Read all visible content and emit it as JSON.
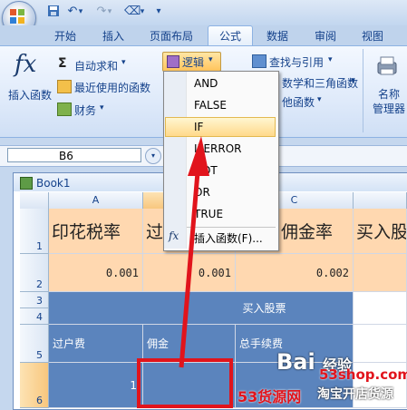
{
  "qat": {
    "save_icon": "save-icon",
    "undo_icon": "undo-icon",
    "redo_icon": "redo-icon",
    "eraser_icon": "eraser-icon",
    "customize": "▾"
  },
  "tabs": [
    "开始",
    "插入",
    "页面布局",
    "公式",
    "数据",
    "审阅",
    "视图"
  ],
  "ribbon": {
    "insert_function": "插入函数",
    "autosum": "自动求和",
    "recent": "最近使用的函数",
    "financial": "财务",
    "logical": "逻辑",
    "lookup": "查找与引用",
    "math_trig": "数学和三角函数",
    "other": "他函数",
    "name_manager": "名称\n管理器"
  },
  "formula_bar": {
    "name_box": "B6"
  },
  "workbook": {
    "title": "Book1"
  },
  "columns": [
    "A",
    "",
    "C",
    ""
  ],
  "rows": [
    "1",
    "2",
    "3",
    "4",
    "5",
    "6"
  ],
  "cells": {
    "A1": "印花税率",
    "B1": "过",
    "C1": "佣金率",
    "D1": "买入股",
    "A2": "0.001",
    "B2": "0.001",
    "C2": "0.002",
    "merged_34": "买入股票",
    "A5": "过户费",
    "B5": "佣金",
    "C5": "总手续费",
    "A6": "1"
  },
  "dropdown": {
    "items": [
      "AND",
      "FALSE",
      "IF",
      "IFERROR",
      "NOT",
      "OR",
      "TRUE"
    ],
    "selected": "IF",
    "insert_function": "插入函数(F)..."
  },
  "colors": {
    "accent_red": "#e1141c",
    "header_fill": "#ffd8b0",
    "table_blue": "#5b84bd",
    "ribbon_blue": "#15428b"
  },
  "watermark": {
    "brand": "Bai",
    "brand2": "经验",
    "site": "53shop.com",
    "slogan_a": "53货源网",
    "slogan_b": "淘宝开店货源"
  }
}
